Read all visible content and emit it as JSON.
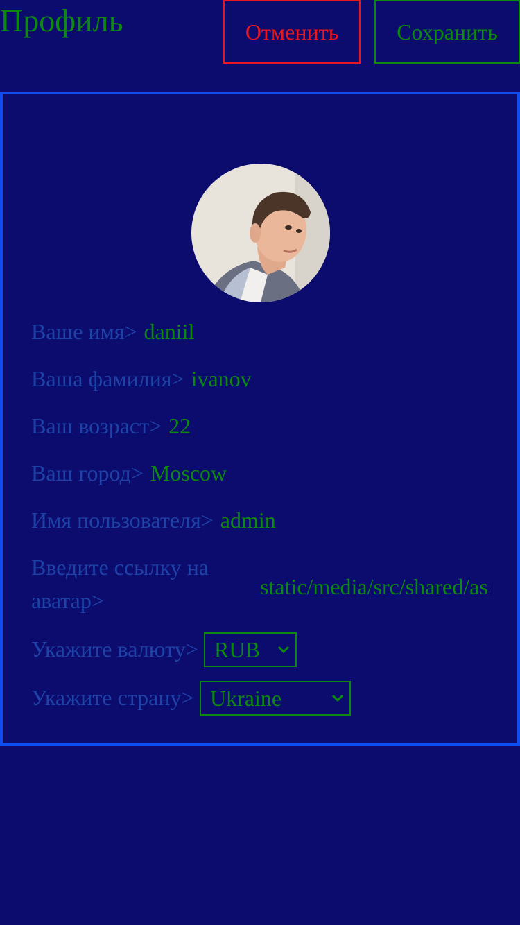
{
  "header": {
    "title": "Профиль",
    "cancel_label": "Отменить",
    "save_label": "Сохранить"
  },
  "profile": {
    "fields": [
      {
        "label": "Ваше имя>",
        "value": "daniil"
      },
      {
        "label": "Ваша фамилия>",
        "value": "ivanov"
      },
      {
        "label": "Ваш возраст>",
        "value": "22"
      },
      {
        "label": "Ваш город>",
        "value": "Moscow"
      },
      {
        "label": "Имя пользователя>",
        "value": "admin"
      }
    ],
    "avatar_url": {
      "label": "Введите ссылку на аватар>",
      "value": "static/media/src/shared/assets"
    },
    "currency": {
      "label": "Укажите валюту>",
      "selected": "RUB"
    },
    "country": {
      "label": "Укажите страну>",
      "selected": "Ukraine"
    }
  },
  "colors": {
    "background": "#0c0c6e",
    "accent_green": "#0c8a10",
    "danger_red": "#e8171f",
    "card_border": "#0f4df0",
    "label_blue": "#1d43a8"
  },
  "icons": {
    "avatar": "user-photo",
    "select_arrow": "chevron-down-icon"
  }
}
